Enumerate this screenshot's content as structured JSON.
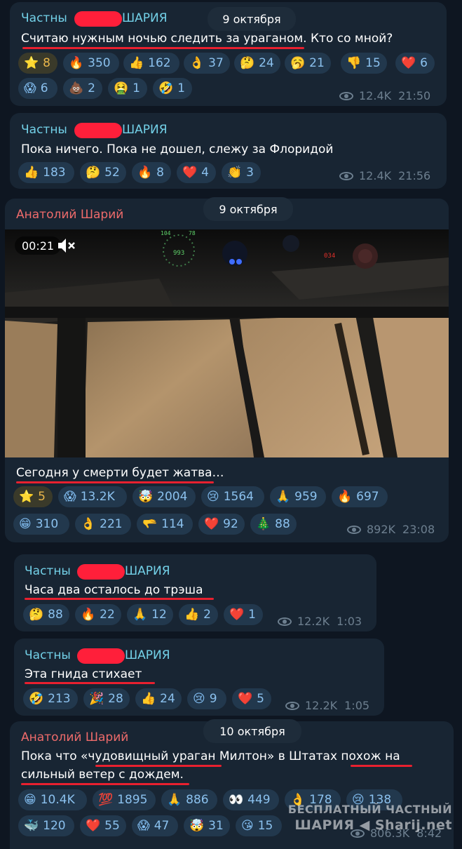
{
  "messages": [
    {
      "sender": "Частный██████ШАРИЯ",
      "sender_left": "Частны",
      "sender_right": "ШАРИЯ",
      "text": "Считаю нужным ночью следить за ураганом. Кто со мной?",
      "reactions": [
        {
          "icon": "star-icon",
          "emoji": "⭐",
          "count": "8"
        },
        {
          "icon": "fire-icon",
          "emoji": "🔥",
          "count": "350"
        },
        {
          "icon": "thumbs-up-icon",
          "emoji": "👍",
          "count": "162"
        },
        {
          "icon": "ok-hand-icon",
          "emoji": "👌",
          "count": "37"
        },
        {
          "icon": "thinking-face-icon",
          "emoji": "🤔",
          "count": "24"
        },
        {
          "icon": "yawning-face-icon",
          "emoji": "🥱",
          "count": "21"
        },
        {
          "icon": "thumbs-down-icon",
          "emoji": "👎",
          "count": "15"
        },
        {
          "icon": "heart-icon",
          "emoji": "❤️",
          "count": "6"
        },
        {
          "icon": "screaming-face-icon",
          "emoji": "😱",
          "count": "6"
        },
        {
          "icon": "poop-icon",
          "emoji": "💩",
          "count": "2"
        },
        {
          "icon": "nauseated-face-icon",
          "emoji": "🤮",
          "count": "1"
        },
        {
          "icon": "rofl-face-icon",
          "emoji": "🤣",
          "count": "1"
        }
      ],
      "views": "12.4K",
      "time": "21:50"
    },
    {
      "sender_left": "Частны",
      "sender_right": "ШАРИЯ",
      "text": "Пока ничего. Пока не дошел, слежу за Флоридой",
      "reactions": [
        {
          "icon": "thumbs-up-icon",
          "emoji": "👍",
          "count": "183"
        },
        {
          "icon": "thinking-face-icon",
          "emoji": "🤔",
          "count": "52"
        },
        {
          "icon": "fire-icon",
          "emoji": "🔥",
          "count": "8"
        },
        {
          "icon": "heart-icon",
          "emoji": "❤️",
          "count": "4"
        },
        {
          "icon": "clapping-hands-icon",
          "emoji": "👏",
          "count": "3"
        }
      ],
      "views": "12.4K",
      "time": "21:56"
    },
    {
      "sender": "Анатолий Шарий",
      "video_time": "00:21",
      "text": "Сегодня у смерти будет жатва…",
      "reactions": [
        {
          "icon": "star-icon",
          "emoji": "⭐",
          "count": "5"
        },
        {
          "icon": "screaming-face-icon",
          "emoji": "😱",
          "count": "13.2K"
        },
        {
          "icon": "exploding-head-icon",
          "emoji": "🤯",
          "count": "2004"
        },
        {
          "icon": "crying-face-icon",
          "emoji": "😢",
          "count": "1564"
        },
        {
          "icon": "folded-hands-icon",
          "emoji": "🙏",
          "count": "959"
        },
        {
          "icon": "fire-icon",
          "emoji": "🔥",
          "count": "697"
        },
        {
          "icon": "grinning-face-icon",
          "emoji": "😁",
          "count": "310"
        },
        {
          "icon": "ok-hand-icon",
          "emoji": "👌",
          "count": "221"
        },
        {
          "icon": "pointing-hand-icon",
          "emoji": "🫳",
          "count": "114"
        },
        {
          "icon": "heart-icon",
          "emoji": "❤️",
          "count": "92"
        },
        {
          "icon": "christmas-tree-icon",
          "emoji": "🎄",
          "count": "88"
        }
      ],
      "views": "892K",
      "time": "23:08"
    },
    {
      "sender_left": "Частны",
      "sender_right": "ШАРИЯ",
      "text": "Часа два осталось до трэша",
      "reactions": [
        {
          "icon": "thinking-face-icon",
          "emoji": "🤔",
          "count": "88"
        },
        {
          "icon": "fire-icon",
          "emoji": "🔥",
          "count": "22"
        },
        {
          "icon": "folded-hands-icon",
          "emoji": "🙏",
          "count": "12"
        },
        {
          "icon": "thumbs-up-icon",
          "emoji": "👍",
          "count": "2"
        },
        {
          "icon": "heart-icon",
          "emoji": "❤️",
          "count": "1"
        }
      ],
      "views": "12.2K",
      "time": "1:03"
    },
    {
      "sender_left": "Частны",
      "sender_right": "ШАРИЯ",
      "text": "Эта гнида стихает",
      "reactions": [
        {
          "icon": "rofl-face-icon",
          "emoji": "🤣",
          "count": "213"
        },
        {
          "icon": "party-popper-icon",
          "emoji": "🎉",
          "count": "28"
        },
        {
          "icon": "thumbs-up-icon",
          "emoji": "👍",
          "count": "24"
        },
        {
          "icon": "crying-face-icon",
          "emoji": "😢",
          "count": "9"
        },
        {
          "icon": "heart-icon",
          "emoji": "❤️",
          "count": "5"
        }
      ],
      "views": "12.2K",
      "time": "1:05"
    },
    {
      "sender": "Анатолий Шарий",
      "text_line1": "Пока что «чудовищный ураган Милтон» в Штатах похож на",
      "text_line2": "сильный ветер с дождем.",
      "reactions": [
        {
          "icon": "grinning-face-icon",
          "emoji": "😁",
          "count": "10.4K"
        },
        {
          "icon": "hundred-points-icon",
          "emoji": "💯",
          "count": "1895"
        },
        {
          "icon": "folded-hands-icon",
          "emoji": "🙏",
          "count": "886"
        },
        {
          "icon": "eyes-icon",
          "emoji": "👀",
          "count": "449"
        },
        {
          "icon": "ok-hand-icon",
          "emoji": "👌",
          "count": "178"
        },
        {
          "icon": "crying-face-icon",
          "emoji": "😢",
          "count": "138"
        },
        {
          "icon": "whale-icon",
          "emoji": "🐳",
          "count": "120"
        },
        {
          "icon": "heart-icon",
          "emoji": "❤️",
          "count": "55"
        },
        {
          "icon": "screaming-face-icon",
          "emoji": "😱",
          "count": "47"
        },
        {
          "icon": "exploding-head-icon",
          "emoji": "🤯",
          "count": "31"
        },
        {
          "icon": "kissing-face-icon",
          "emoji": "😘",
          "count": "15"
        }
      ],
      "views": "806.3K",
      "time": "8:42"
    }
  ],
  "dates": {
    "d1": "9 октября",
    "d2": "9 октября",
    "d3": "10 октября"
  },
  "watermark": {
    "line1": "БЕСПЛАТНЫЙ ЧАСТНЫЙ",
    "line2": "ШАРИЯ ◀ Sharij.net"
  },
  "colors": {
    "background": "#0e1621",
    "bubble": "#182533",
    "channel_name": "#73d1e8",
    "author_name": "#ee6b6b",
    "reaction_bg": "#22384d",
    "reaction_count": "#82bdf0",
    "underline": "#e8202f",
    "redaction": "#ff1f3a"
  }
}
